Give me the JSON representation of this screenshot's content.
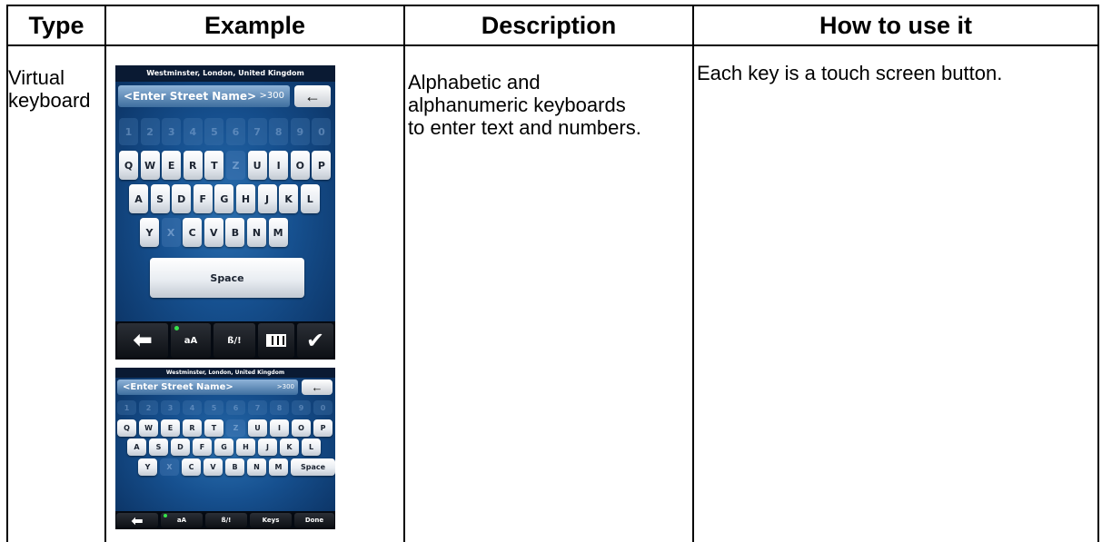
{
  "headers": [
    "Type",
    "Example",
    "Description",
    "How to use it"
  ],
  "row": {
    "type_line1": "Virtual",
    "type_line2": "keyboard",
    "description_lines": [
      "Alphabetic and",
      "alphanumeric keyboards",
      "to enter text and numbers."
    ],
    "how_to_use": "Each key is a touch screen button."
  },
  "keyboard_large": {
    "location": "Westminster, London, United Kingdom",
    "placeholder": "<Enter Street Name>",
    "count": ">300",
    "numbers": [
      "1",
      "2",
      "3",
      "4",
      "5",
      "6",
      "7",
      "8",
      "9",
      "0"
    ],
    "row1": [
      "Q",
      "W",
      "E",
      "R",
      "T",
      "Z",
      "U",
      "I",
      "O",
      "P"
    ],
    "row2": [
      "A",
      "S",
      "D",
      "F",
      "G",
      "H",
      "J",
      "K",
      "L"
    ],
    "row3": [
      "Y",
      "X",
      "C",
      "V",
      "B",
      "N",
      "M"
    ],
    "space": "Space",
    "bottom": {
      "case": "aA",
      "symbols": "ß/!"
    }
  },
  "keyboard_small": {
    "location": "Westminster, London, United Kingdom",
    "placeholder": "<Enter Street Name>",
    "count": ">300",
    "numbers": [
      "1",
      "2",
      "3",
      "4",
      "5",
      "6",
      "7",
      "8",
      "9",
      "0"
    ],
    "row1": [
      "Q",
      "W",
      "E",
      "R",
      "T",
      "Z",
      "U",
      "I",
      "O",
      "P"
    ],
    "row2": [
      "A",
      "S",
      "D",
      "F",
      "G",
      "H",
      "J",
      "K",
      "L"
    ],
    "row3": [
      "Y",
      "X",
      "C",
      "V",
      "B",
      "N",
      "M"
    ],
    "space": "Space",
    "bottom": {
      "case": "aA",
      "symbols": "ß/!",
      "keys": "Keys",
      "done": "Done"
    }
  },
  "colors": {
    "keyboard_bg": "#16508f",
    "led": "#37e34a",
    "border": "#000000"
  }
}
